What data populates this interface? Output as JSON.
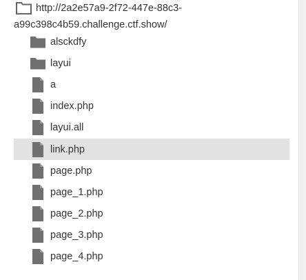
{
  "root": {
    "path_line1": "http://2a2e57a9-2f72-447e-88c3-",
    "path_line2": "a99c398c4b59.challenge.ctf.show/",
    "icon": "folder-outline-icon"
  },
  "items": [
    {
      "label": "alsckdfy",
      "type": "folder",
      "icon": "folder-icon",
      "selected": false
    },
    {
      "label": "layui",
      "type": "folder",
      "icon": "folder-icon",
      "selected": false
    },
    {
      "label": "a",
      "type": "file",
      "icon": "file-icon",
      "selected": false
    },
    {
      "label": "index.php",
      "type": "file",
      "icon": "file-icon",
      "selected": false
    },
    {
      "label": "layui.all",
      "type": "file",
      "icon": "file-icon",
      "selected": false
    },
    {
      "label": "link.php",
      "type": "file",
      "icon": "file-icon",
      "selected": true
    },
    {
      "label": "page.php",
      "type": "file",
      "icon": "file-icon",
      "selected": false
    },
    {
      "label": "page_1.php",
      "type": "file",
      "icon": "file-icon",
      "selected": false
    },
    {
      "label": "page_2.php",
      "type": "file",
      "icon": "file-icon",
      "selected": false
    },
    {
      "label": "page_3.php",
      "type": "file",
      "icon": "file-icon",
      "selected": false
    },
    {
      "label": "page_4.php",
      "type": "file",
      "icon": "file-icon",
      "selected": false
    }
  ],
  "colors": {
    "icon_fill": "#707070",
    "selected_bg": "#e2e2e2",
    "text": "#333333"
  }
}
